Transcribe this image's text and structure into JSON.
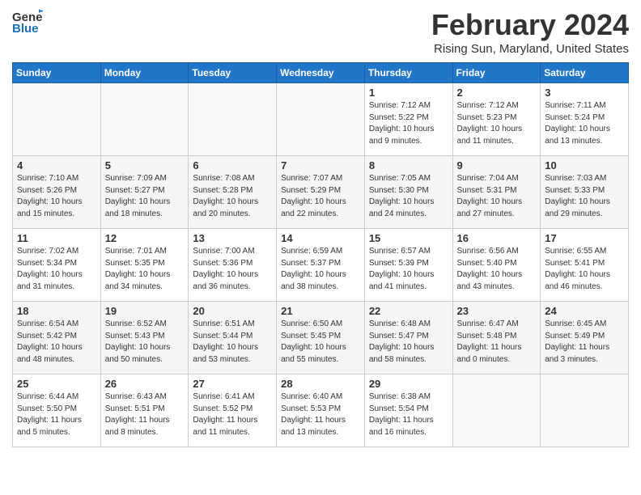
{
  "header": {
    "logo_general": "General",
    "logo_blue": "Blue",
    "month": "February 2024",
    "location": "Rising Sun, Maryland, United States"
  },
  "days_of_week": [
    "Sunday",
    "Monday",
    "Tuesday",
    "Wednesday",
    "Thursday",
    "Friday",
    "Saturday"
  ],
  "weeks": [
    {
      "days": [
        {
          "num": "",
          "info": ""
        },
        {
          "num": "",
          "info": ""
        },
        {
          "num": "",
          "info": ""
        },
        {
          "num": "",
          "info": ""
        },
        {
          "num": "1",
          "info": "Sunrise: 7:12 AM\nSunset: 5:22 PM\nDaylight: 10 hours\nand 9 minutes."
        },
        {
          "num": "2",
          "info": "Sunrise: 7:12 AM\nSunset: 5:23 PM\nDaylight: 10 hours\nand 11 minutes."
        },
        {
          "num": "3",
          "info": "Sunrise: 7:11 AM\nSunset: 5:24 PM\nDaylight: 10 hours\nand 13 minutes."
        }
      ]
    },
    {
      "days": [
        {
          "num": "4",
          "info": "Sunrise: 7:10 AM\nSunset: 5:26 PM\nDaylight: 10 hours\nand 15 minutes."
        },
        {
          "num": "5",
          "info": "Sunrise: 7:09 AM\nSunset: 5:27 PM\nDaylight: 10 hours\nand 18 minutes."
        },
        {
          "num": "6",
          "info": "Sunrise: 7:08 AM\nSunset: 5:28 PM\nDaylight: 10 hours\nand 20 minutes."
        },
        {
          "num": "7",
          "info": "Sunrise: 7:07 AM\nSunset: 5:29 PM\nDaylight: 10 hours\nand 22 minutes."
        },
        {
          "num": "8",
          "info": "Sunrise: 7:05 AM\nSunset: 5:30 PM\nDaylight: 10 hours\nand 24 minutes."
        },
        {
          "num": "9",
          "info": "Sunrise: 7:04 AM\nSunset: 5:31 PM\nDaylight: 10 hours\nand 27 minutes."
        },
        {
          "num": "10",
          "info": "Sunrise: 7:03 AM\nSunset: 5:33 PM\nDaylight: 10 hours\nand 29 minutes."
        }
      ]
    },
    {
      "days": [
        {
          "num": "11",
          "info": "Sunrise: 7:02 AM\nSunset: 5:34 PM\nDaylight: 10 hours\nand 31 minutes."
        },
        {
          "num": "12",
          "info": "Sunrise: 7:01 AM\nSunset: 5:35 PM\nDaylight: 10 hours\nand 34 minutes."
        },
        {
          "num": "13",
          "info": "Sunrise: 7:00 AM\nSunset: 5:36 PM\nDaylight: 10 hours\nand 36 minutes."
        },
        {
          "num": "14",
          "info": "Sunrise: 6:59 AM\nSunset: 5:37 PM\nDaylight: 10 hours\nand 38 minutes."
        },
        {
          "num": "15",
          "info": "Sunrise: 6:57 AM\nSunset: 5:39 PM\nDaylight: 10 hours\nand 41 minutes."
        },
        {
          "num": "16",
          "info": "Sunrise: 6:56 AM\nSunset: 5:40 PM\nDaylight: 10 hours\nand 43 minutes."
        },
        {
          "num": "17",
          "info": "Sunrise: 6:55 AM\nSunset: 5:41 PM\nDaylight: 10 hours\nand 46 minutes."
        }
      ]
    },
    {
      "days": [
        {
          "num": "18",
          "info": "Sunrise: 6:54 AM\nSunset: 5:42 PM\nDaylight: 10 hours\nand 48 minutes."
        },
        {
          "num": "19",
          "info": "Sunrise: 6:52 AM\nSunset: 5:43 PM\nDaylight: 10 hours\nand 50 minutes."
        },
        {
          "num": "20",
          "info": "Sunrise: 6:51 AM\nSunset: 5:44 PM\nDaylight: 10 hours\nand 53 minutes."
        },
        {
          "num": "21",
          "info": "Sunrise: 6:50 AM\nSunset: 5:45 PM\nDaylight: 10 hours\nand 55 minutes."
        },
        {
          "num": "22",
          "info": "Sunrise: 6:48 AM\nSunset: 5:47 PM\nDaylight: 10 hours\nand 58 minutes."
        },
        {
          "num": "23",
          "info": "Sunrise: 6:47 AM\nSunset: 5:48 PM\nDaylight: 11 hours\nand 0 minutes."
        },
        {
          "num": "24",
          "info": "Sunrise: 6:45 AM\nSunset: 5:49 PM\nDaylight: 11 hours\nand 3 minutes."
        }
      ]
    },
    {
      "days": [
        {
          "num": "25",
          "info": "Sunrise: 6:44 AM\nSunset: 5:50 PM\nDaylight: 11 hours\nand 5 minutes."
        },
        {
          "num": "26",
          "info": "Sunrise: 6:43 AM\nSunset: 5:51 PM\nDaylight: 11 hours\nand 8 minutes."
        },
        {
          "num": "27",
          "info": "Sunrise: 6:41 AM\nSunset: 5:52 PM\nDaylight: 11 hours\nand 11 minutes."
        },
        {
          "num": "28",
          "info": "Sunrise: 6:40 AM\nSunset: 5:53 PM\nDaylight: 11 hours\nand 13 minutes."
        },
        {
          "num": "29",
          "info": "Sunrise: 6:38 AM\nSunset: 5:54 PM\nDaylight: 11 hours\nand 16 minutes."
        },
        {
          "num": "",
          "info": ""
        },
        {
          "num": "",
          "info": ""
        }
      ]
    }
  ]
}
